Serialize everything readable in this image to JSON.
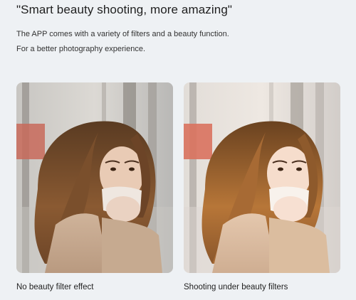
{
  "heading": "\"Smart beauty shooting, more amazing\"",
  "description": {
    "line1": "The APP comes with a variety of filters and a beauty function.",
    "line2": "For a better photography experience."
  },
  "comparison": {
    "before": {
      "caption": "No beauty filter effect"
    },
    "after": {
      "caption": "Shooting under beauty filters"
    }
  }
}
